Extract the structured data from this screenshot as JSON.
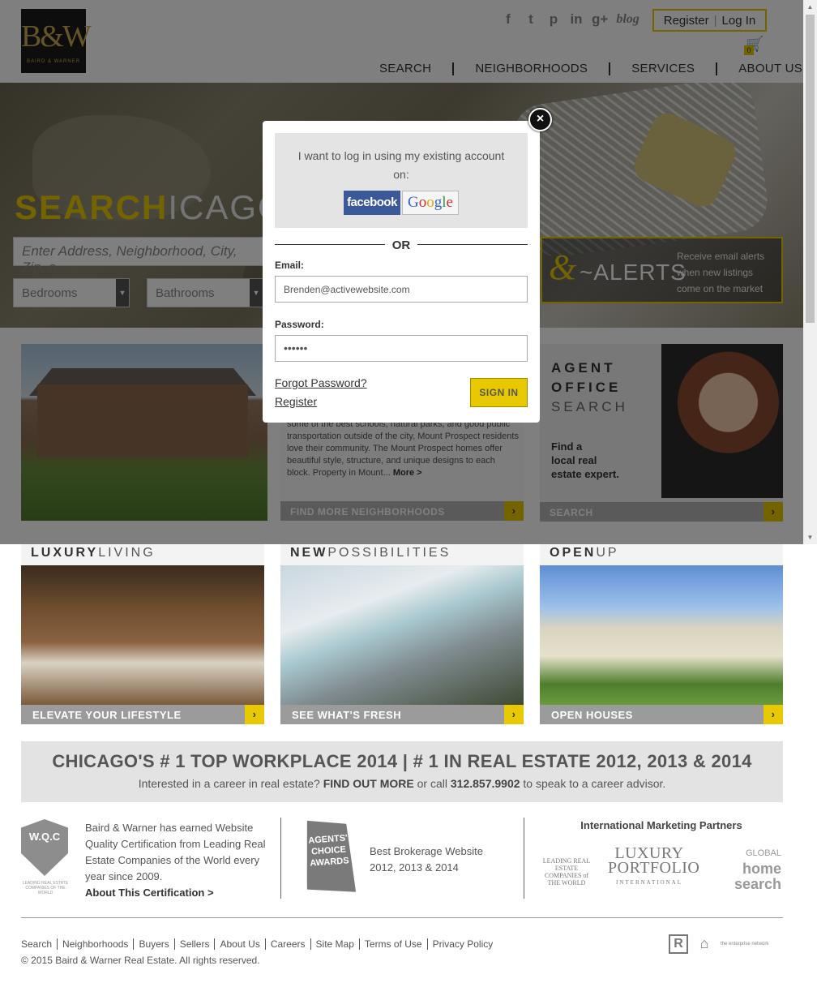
{
  "header": {
    "logo_mark": "B&W",
    "logo_sub": "BAIRD & WARNER",
    "social": [
      "f",
      "t",
      "p",
      "in",
      "g+"
    ],
    "social_blog": "blog",
    "register": "Register",
    "login": "Log In",
    "cart_count": "0",
    "nav": [
      "SEARCH",
      "NEIGHBORHOODS",
      "SERVICES",
      "ABOUT US"
    ]
  },
  "hero": {
    "title_bold": "SEARCH",
    "title_thin": "ICAGO",
    "search_placeholder": "Enter Address, Neighborhood, City, Zip, o",
    "bedrooms": "Bedrooms",
    "bathrooms": "Bathrooms",
    "alerts_word": "~ALERTS",
    "alerts_text": "Receive email alerts when new listings come on the market"
  },
  "neighborhood": {
    "text_lines": "some of the best schools, natural parks, and good public transportation outside of the city, Mount Prospect residents love their community. The Mount Prospect homes offer beautiful style, structure, and unique designs to each block. Property in Mount...",
    "more": "More >",
    "cta": "FIND MORE NEIGHBORHOODS"
  },
  "agent": {
    "line1": "AGENT",
    "line2": "OFFICE",
    "line3": "SEARCH",
    "find": "Find a",
    "find2": "local real",
    "find3": "estate expert.",
    "cta": "SEARCH"
  },
  "modal": {
    "prompt": "I want to log in using my existing account on:",
    "facebook": "facebook",
    "or": "OR",
    "email_label": "Email:",
    "email_value": "Brenden@activewebsite.com",
    "password_label": "Password:",
    "password_value": "••••••",
    "forgot": "Forgot Password?",
    "register": "Register",
    "signin": "SIGN IN",
    "close": "×"
  },
  "promos": [
    {
      "bold": "LUXURY",
      "thin": "LIVING",
      "cta": "ELEVATE YOUR LIFESTYLE"
    },
    {
      "bold": "NEW",
      "thin": "POSSIBILITIES",
      "cta": "SEE WHAT'S FRESH"
    },
    {
      "bold": "OPEN",
      "thin": "UP",
      "cta": "OPEN HOUSES"
    }
  ],
  "workplace": {
    "headline": "CHICAGO'S # 1 TOP WORKPLACE 2014 | # 1 IN REAL ESTATE 2012, 2013 & 2014",
    "sub_pre": "Interested in a career in real estate?",
    "sub_link": "FIND OUT MORE",
    "sub_mid": "or call",
    "phone": "312.857.9902",
    "sub_post": "to speak to a career advisor."
  },
  "certs": {
    "wqc": "W.Q.C",
    "wqc_small": "LEADING REAL ESTATE COMPANIES OF THE WORLD",
    "text": "Baird & Warner has earned Website Quality Certification from Leading Real Estate Companies of the World every year since 2009.",
    "link": "About This Certification >",
    "agents_badge": "AGENTS' CHOICE AWARDS",
    "best": "Best Brokerage Website",
    "years": "2012, 2013 & 2014",
    "partners_heading": "International Marketing Partners",
    "p1": "LEADING REAL ESTATE COMPANIES of THE WORLD",
    "p2_a": "LUXURY",
    "p2_b": "PORTFOLIO",
    "p2_c": "INTERNATIONAL",
    "p3_a": "GLOBAL",
    "p3_b": "home",
    "p3_c": "search"
  },
  "footer": {
    "links": [
      "Search",
      "Neighborhoods",
      "Buyers",
      "Sellers",
      "About Us",
      "Careers",
      "Site Map",
      "Terms of Use",
      "Privacy Policy"
    ],
    "copyright": "© 2015 Baird & Warner Real Estate. All rights reserved.",
    "enterprise": "the enterprise network"
  }
}
